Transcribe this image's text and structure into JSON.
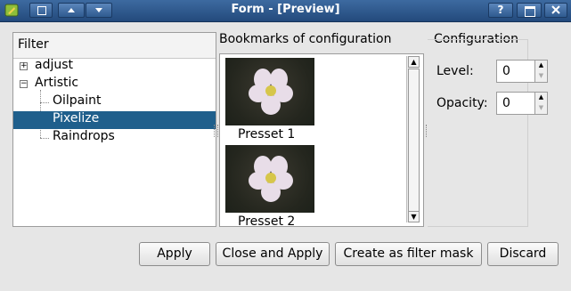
{
  "window": {
    "title": "Form - [Preview]",
    "help_label": "?"
  },
  "filter_tree": {
    "header": "Filter",
    "items": [
      {
        "label": "adjust",
        "expander": "+"
      },
      {
        "label": "Artistic",
        "expander": "−"
      },
      {
        "label": "Oilpaint"
      },
      {
        "label": "Pixelize",
        "selected": true
      },
      {
        "label": "Raindrops"
      }
    ]
  },
  "bookmarks": {
    "header": "Bookmarks of configuration",
    "items": [
      {
        "label": "Presset 1"
      },
      {
        "label": "Presset 2"
      }
    ]
  },
  "configuration": {
    "header": "Configuration",
    "level_label": "Level:",
    "level_value": "0",
    "opacity_label": "Opacity:",
    "opacity_value": "0"
  },
  "buttons": {
    "apply": "Apply",
    "close_apply": "Close and Apply",
    "create_mask": "Create as filter mask",
    "discard": "Discard"
  },
  "colors": {
    "selection": "#1f5f8c",
    "titlebar": "#2e5a8e"
  }
}
